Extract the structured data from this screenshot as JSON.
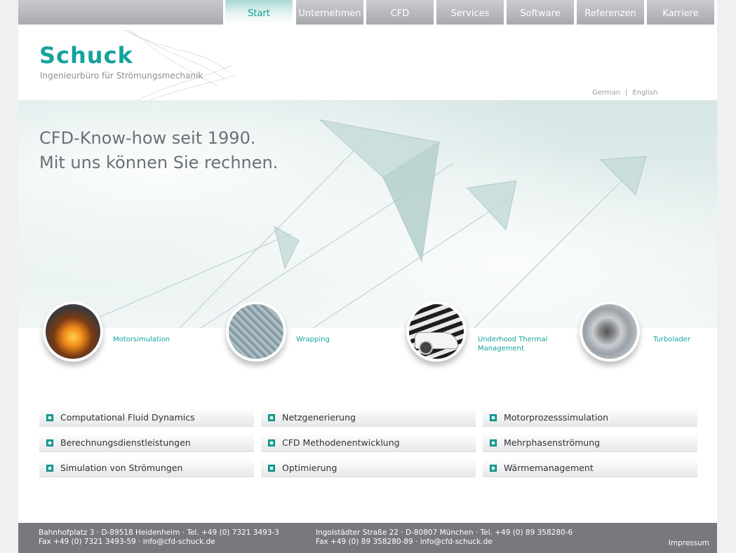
{
  "nav": {
    "items": [
      {
        "label": "Start",
        "active": true
      },
      {
        "label": "Unternehmen"
      },
      {
        "label": "CFD"
      },
      {
        "label": "Services"
      },
      {
        "label": "Software"
      },
      {
        "label": "Referenzen"
      },
      {
        "label": "Karriere"
      }
    ]
  },
  "logo": {
    "title": "Schuck",
    "subtitle": "Ingenieurbüro für Strömungsmechanik"
  },
  "lang": {
    "german": "German",
    "separator": "|",
    "english": "English"
  },
  "hero": {
    "line1": "CFD-Know-how seit 1990.",
    "line2": "Mit uns können Sie rechnen."
  },
  "features": [
    {
      "label": "Motorsimulation",
      "icon": "engine-fire-image"
    },
    {
      "label": "Wrapping",
      "icon": "engine-mesh-image"
    },
    {
      "label": "Underhood Thermal Management",
      "icon": "car-image"
    },
    {
      "label": "Turbolader",
      "icon": "turbocharger-image"
    }
  ],
  "links": {
    "col1": [
      "Computational Fluid Dynamics",
      "Berechnungsdienstleistungen",
      "Simulation von Strömungen"
    ],
    "col2": [
      "Netzgenerierung",
      "CFD Methodenentwicklung",
      "Optimierung"
    ],
    "col3": [
      "Motorprozesssimulation",
      "Mehrphasenströmung",
      "Wärmemanagement"
    ]
  },
  "footer": {
    "heidenheim_line1": "Bahnhofplatz 3 · D-89518 Heidenheim · Tel. +49 (0) 7321 3493-3",
    "heidenheim_line2": "Fax +49 (0) 7321 3493-59 · info@cfd-schuck.de",
    "muenchen_line1": "Ingolstädter Straße 22 · D-80807 München · Tel. +49 (0) 89 358280-6",
    "muenchen_line2": "Fax +49 (0) 89 358280-89 · info@cfd-schuck.de",
    "impressum": "Impressum"
  },
  "colors": {
    "accent": "#15a39a",
    "nav_gray": "#a7a9ac",
    "footer_bg": "#77797d"
  }
}
